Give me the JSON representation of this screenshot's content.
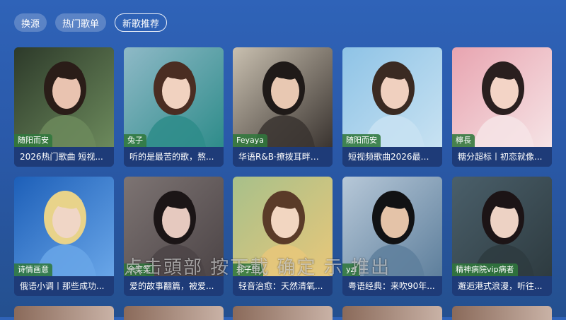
{
  "tabs": [
    {
      "label": "换源",
      "active": false
    },
    {
      "label": "热门歌单",
      "active": false
    },
    {
      "label": "新歌推荐",
      "active": true
    }
  ],
  "cards": [
    {
      "tag": "随阳而安",
      "title": "2026热门歌曲 短视...",
      "palette": [
        "#2d3a2a",
        "#6c8a5c",
        "#e9c3b0",
        "#2a1d18"
      ]
    },
    {
      "tag": "兔子",
      "title": "听的是最苦的歌，熬...",
      "palette": [
        "#8fb9c7",
        "#2e8c8a",
        "#f1d2c0",
        "#4a2d22"
      ]
    },
    {
      "tag": "Feyaya",
      "title": "华语R&B·撩拨耳畔的...",
      "palette": [
        "#c9c0b0",
        "#3a3430",
        "#e8c8b2",
        "#1f1a18"
      ]
    },
    {
      "tag": "随阳而安",
      "title": "短视频歌曲2026最火...",
      "palette": [
        "#8ec3e6",
        "#c8e2f2",
        "#f0d0bf",
        "#3a2a22"
      ]
    },
    {
      "tag": "檸長",
      "title": "糖分超标丨初恋就像...",
      "palette": [
        "#e8a4b0",
        "#f6e4e6",
        "#f3d4c6",
        "#2a1f1f"
      ]
    },
    {
      "tag": "诗情画意",
      "title": "俄语小调丨那些成功...",
      "palette": [
        "#1d5fb8",
        "#69a6e8",
        "#f0d6c6",
        "#e8d38a"
      ]
    },
    {
      "tag": "余笑笑",
      "title": "爱的故事翻篇，被爱...",
      "palette": [
        "#7d7473",
        "#4c4446",
        "#e6c9bf",
        "#1b1516"
      ]
    },
    {
      "tag": "郑子怡",
      "title": "轻音治愈：天然清氧...",
      "palette": [
        "#a7c08a",
        "#e8c77a",
        "#f2d6c1",
        "#5a3b28"
      ]
    },
    {
      "tag": "yzl",
      "title": "粤语经典：来吹90年...",
      "palette": [
        "#b7c8d8",
        "#5e7f9c",
        "#e4c3a8",
        "#111214"
      ]
    },
    {
      "tag": "精神病院vip病者",
      "title": "邂逅港式浪漫，听往...",
      "palette": [
        "#4a5f6a",
        "#2e3b40",
        "#edd2c4",
        "#1c1416"
      ]
    }
  ],
  "overlay_text": "点击頭部 按下載 确定 示 推出"
}
